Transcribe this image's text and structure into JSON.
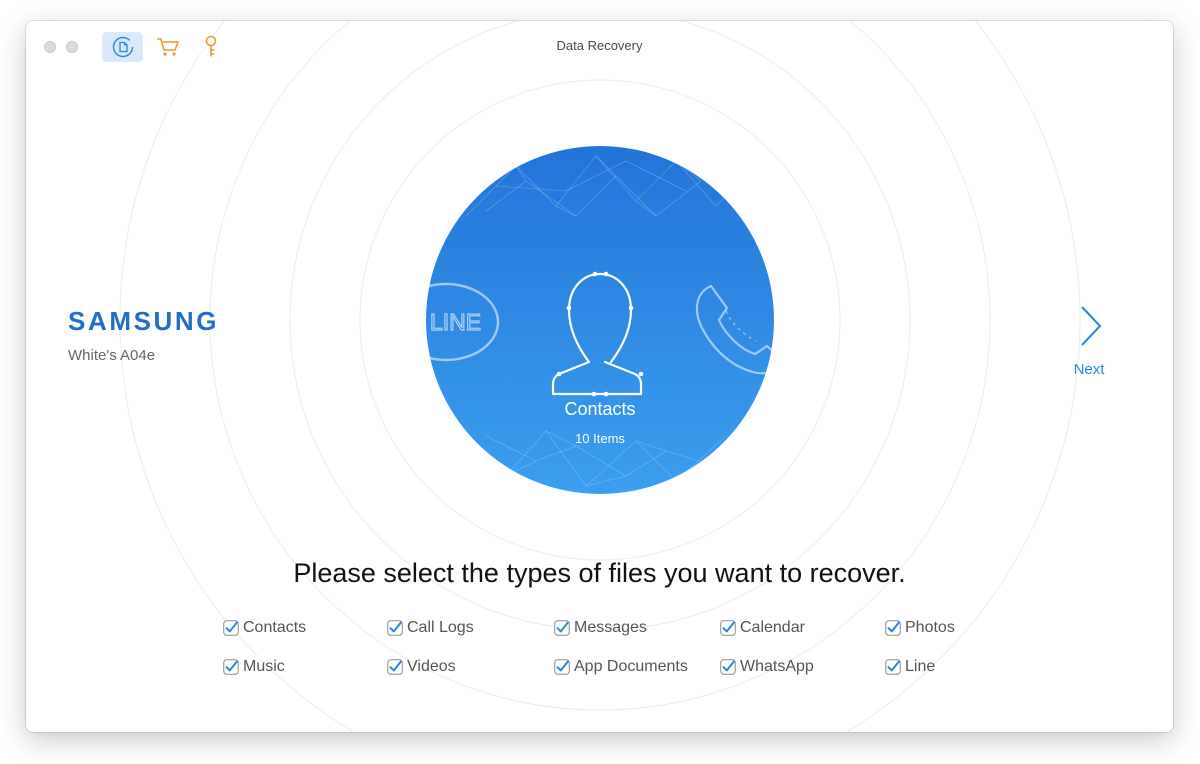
{
  "window": {
    "title": "Data Recovery"
  },
  "toolbar": [
    {
      "icon": "recovery-icon",
      "active": true
    },
    {
      "icon": "cart-icon",
      "active": false
    },
    {
      "icon": "key-icon",
      "active": false
    }
  ],
  "device": {
    "brand": "SAMSUNG",
    "model": "White's A04e"
  },
  "featured": {
    "category": "Contacts",
    "count": "10 Items",
    "side_left_icon": "line-icon",
    "side_right_icon": "phone-icon",
    "center_icon": "person-icon"
  },
  "next": {
    "label": "Next"
  },
  "prompt": "Please select the types of files you want to recover.",
  "file_types": [
    {
      "label": "Contacts",
      "checked": true
    },
    {
      "label": "Call Logs",
      "checked": true
    },
    {
      "label": "Messages",
      "checked": true
    },
    {
      "label": "Calendar",
      "checked": true
    },
    {
      "label": "Photos",
      "checked": true
    },
    {
      "label": "Music",
      "checked": true
    },
    {
      "label": "Videos",
      "checked": true
    },
    {
      "label": "App Documents",
      "checked": true
    },
    {
      "label": "WhatsApp",
      "checked": true
    },
    {
      "label": "Line",
      "checked": true
    }
  ],
  "colors": {
    "accent": "#2b86e0",
    "toolbar_orange": "#f0982d",
    "brand_blue": "#1f6fc9",
    "disc_top": "#2274d8",
    "disc_bottom": "#3c9ff0"
  }
}
